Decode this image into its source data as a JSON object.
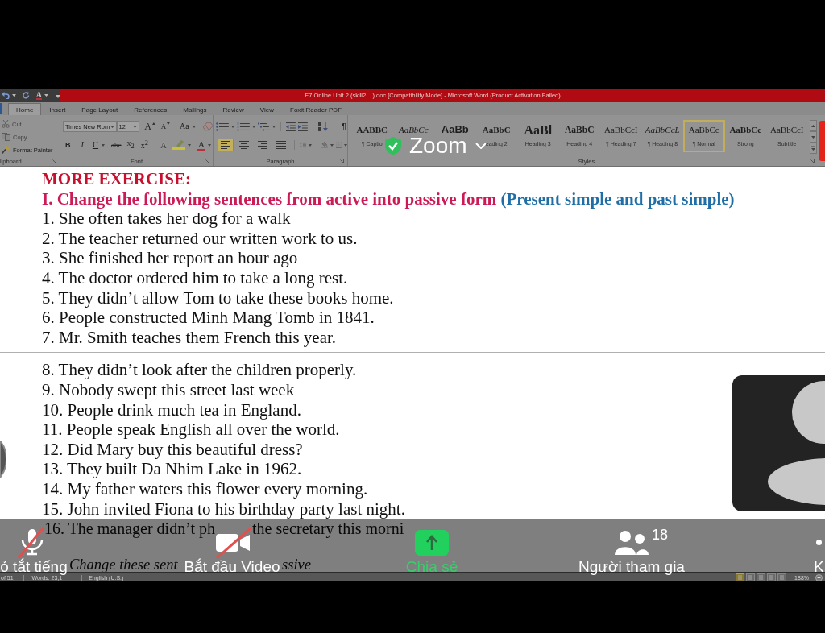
{
  "title_bar": {
    "title": "E7 Online Unit 2 (skill2 ...).doc [Compatibility Mode] - Microsoft Word (Product Activation Failed)",
    "font_color_label": "A"
  },
  "tabs": [
    {
      "label": "Home",
      "selected": true
    },
    {
      "label": "Insert",
      "selected": false
    },
    {
      "label": "Page Layout",
      "selected": false
    },
    {
      "label": "References",
      "selected": false
    },
    {
      "label": "Mailings",
      "selected": false
    },
    {
      "label": "Review",
      "selected": false
    },
    {
      "label": "View",
      "selected": false
    },
    {
      "label": "Foxit Reader PDF",
      "selected": false
    }
  ],
  "clipboard": {
    "commands": [
      {
        "kind": "cut",
        "label": "Cut",
        "disabled": true
      },
      {
        "kind": "copy",
        "label": "Copy",
        "disabled": true
      },
      {
        "kind": "painter",
        "label": "Format Painter",
        "disabled": false
      }
    ],
    "group_label": "lipboard"
  },
  "font": {
    "font_name": "Times New Rom",
    "font_size": "12",
    "sizing": [
      {
        "kind": "grow",
        "label": "A"
      },
      {
        "kind": "shrink",
        "label": "A"
      },
      {
        "kind": "case",
        "label": "Aa"
      }
    ],
    "formatting": [
      {
        "kind": "bold",
        "label": "B",
        "disabled": false
      },
      {
        "kind": "italic",
        "label": "I",
        "disabled": false
      },
      {
        "kind": "underline",
        "label": "U",
        "disabled": false
      },
      {
        "kind": "strike",
        "label": "abc",
        "disabled": false
      },
      {
        "kind": "subscript",
        "label": "x$_{2}$",
        "disabled": false
      },
      {
        "kind": "superscript",
        "label": "x$^{2}$",
        "disabled": false
      },
      {
        "kind": "effects",
        "label": "A",
        "disabled": true
      },
      {
        "kind": "highlight",
        "disabled": false
      },
      {
        "kind": "color",
        "label": "A",
        "disabled": false
      }
    ],
    "group_label": "Font"
  },
  "paragraph": {
    "show_marks_label": "¶",
    "alignments": [
      {
        "kind": "left",
        "selected": true
      },
      {
        "kind": "center",
        "selected": false
      },
      {
        "kind": "right",
        "selected": false
      },
      {
        "kind": "justify",
        "selected": false
      }
    ],
    "group_label": "Paragraph"
  },
  "styles": {
    "gallery": [
      {
        "kind": "caption",
        "preview": "AABBC",
        "name": "¶ Captio",
        "selected": false
      },
      {
        "kind": "emphasis",
        "preview": "AaBbCc",
        "selected": false
      },
      {
        "kind": "heading1",
        "preview": "AaBb",
        "selected": false
      },
      {
        "kind": "heading2",
        "preview": "AaBbC",
        "name": "eading 2",
        "selected": false
      },
      {
        "kind": "heading3",
        "preview": "AaBl",
        "name": "Heading 3",
        "selected": false
      },
      {
        "kind": "heading4",
        "preview": "AaBbC",
        "name": "Heading 4",
        "selected": false
      },
      {
        "kind": "plain",
        "preview": "AaBbCcI",
        "name": "¶ Heading 7",
        "selected": false
      },
      {
        "kind": "italic",
        "preview": "AaBbCcL",
        "name": "¶ Heading 8",
        "selected": false
      },
      {
        "kind": "plain",
        "preview": "AaBbCc",
        "name": "¶ Normal",
        "selected": true
      },
      {
        "kind": "bold",
        "preview": "AaBbCc",
        "name": "Strong",
        "selected": false
      },
      {
        "kind": "plain",
        "preview": "AaBbCcI",
        "name": "Subtitle",
        "selected": false
      }
    ],
    "group_label": "Styles"
  },
  "meeting_header": {
    "title": "Zoom"
  },
  "document": {
    "heading": "MORE EXERCISE:",
    "instruction": {
      "text": "I. Change the following sentences from active into passive form",
      "note": "(Present simple and past simple)"
    },
    "page_1": [
      "1. She often takes her dog for a walk",
      "2. The teacher returned our written work to us.",
      "3. She finished her report an hour ago",
      "4. The doctor ordered him to take a long rest.",
      "5. They didn’t allow Tom to take these books home.",
      "6. People constructed Minh Mang Tomb in 1841.",
      "7. Mr. Smith teaches them French this year."
    ],
    "page_2": [
      "8. They didn’t look after the children properly.",
      "9. Nobody swept this street last week",
      "10. People drink much tea in England.",
      "11. People speak English all over the world.",
      "12. Did Mary buy this beautiful dress?",
      "13. They built Da Nhim Lake in 1962.",
      "14. My father waters this flower every morning.",
      "15. John invited Fiona to his birthday party last night."
    ],
    "fragments": [
      {
        "kind": "plain",
        "parts": [
          "16. The manager didn’t ph",
          "the secretary this morni"
        ]
      },
      {
        "kind": "italic",
        "parts": [
          "Change these sent",
          "ssive"
        ]
      }
    ]
  },
  "status_bar": {
    "page": "of 51",
    "words": "Words: 23,1",
    "language": "English (U.S.)",
    "views": [
      {
        "selected": true
      },
      {
        "selected": false
      },
      {
        "selected": false
      },
      {
        "selected": false
      },
      {
        "selected": false
      }
    ],
    "zoom_level": "188%"
  },
  "meeting_toolbar": [
    {
      "kind": "mute",
      "label": "ỏ tắt tiếng",
      "off": true
    },
    {
      "kind": "video",
      "label": "Bắt đầu Video",
      "off": true
    },
    {
      "kind": "share",
      "label": "Chia sẻ",
      "off": false
    },
    {
      "kind": "participants",
      "label": "Người tham gia",
      "count": "18",
      "off": false
    },
    {
      "kind": "more",
      "label": "K",
      "off": false
    }
  ]
}
